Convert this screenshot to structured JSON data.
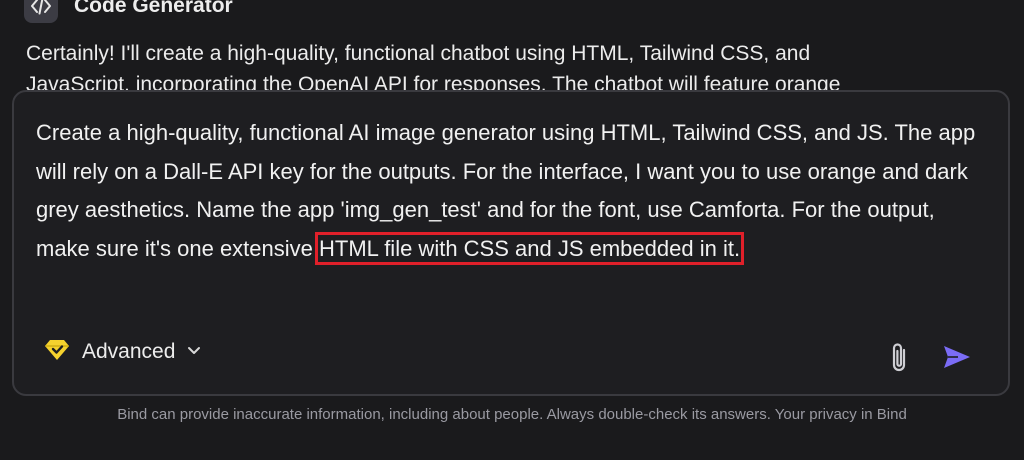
{
  "header": {
    "title": "Code Generator",
    "icon": "code-icon"
  },
  "message": {
    "line1": "Certainly! I'll create a high-quality, functional chatbot using HTML, Tailwind CSS, and",
    "line2": "JavaScript, incorporating the OpenAI API for responses. The chatbot will feature orange"
  },
  "composer": {
    "prompt_text": "Create a high-quality, functional AI image generator using HTML, Tailwind CSS, and JS. The app will rely on a Dall-E API key for the outputs. For the interface, I want you to use orange and dark grey aesthetics. Name the app 'img_gen_test' and for the font, use Camforta. For the output, make sure it's one extensive ",
    "prompt_highlight": "HTML file with CSS and JS embedded in it.",
    "model_label": "Advanced",
    "model_icon": "gem-icon",
    "attach_icon": "paperclip-icon",
    "send_icon": "send-icon"
  },
  "footer": {
    "disclaimer": "Bind can provide inaccurate information, including about people. Always double-check its answers. Your privacy in Bind"
  },
  "colors": {
    "background": "#1a1a1c",
    "composer_border": "#3a3a3f",
    "highlight_border": "#e0202a",
    "send_accent": "#7b6cf6",
    "gem_yellow": "#f5d22e"
  }
}
